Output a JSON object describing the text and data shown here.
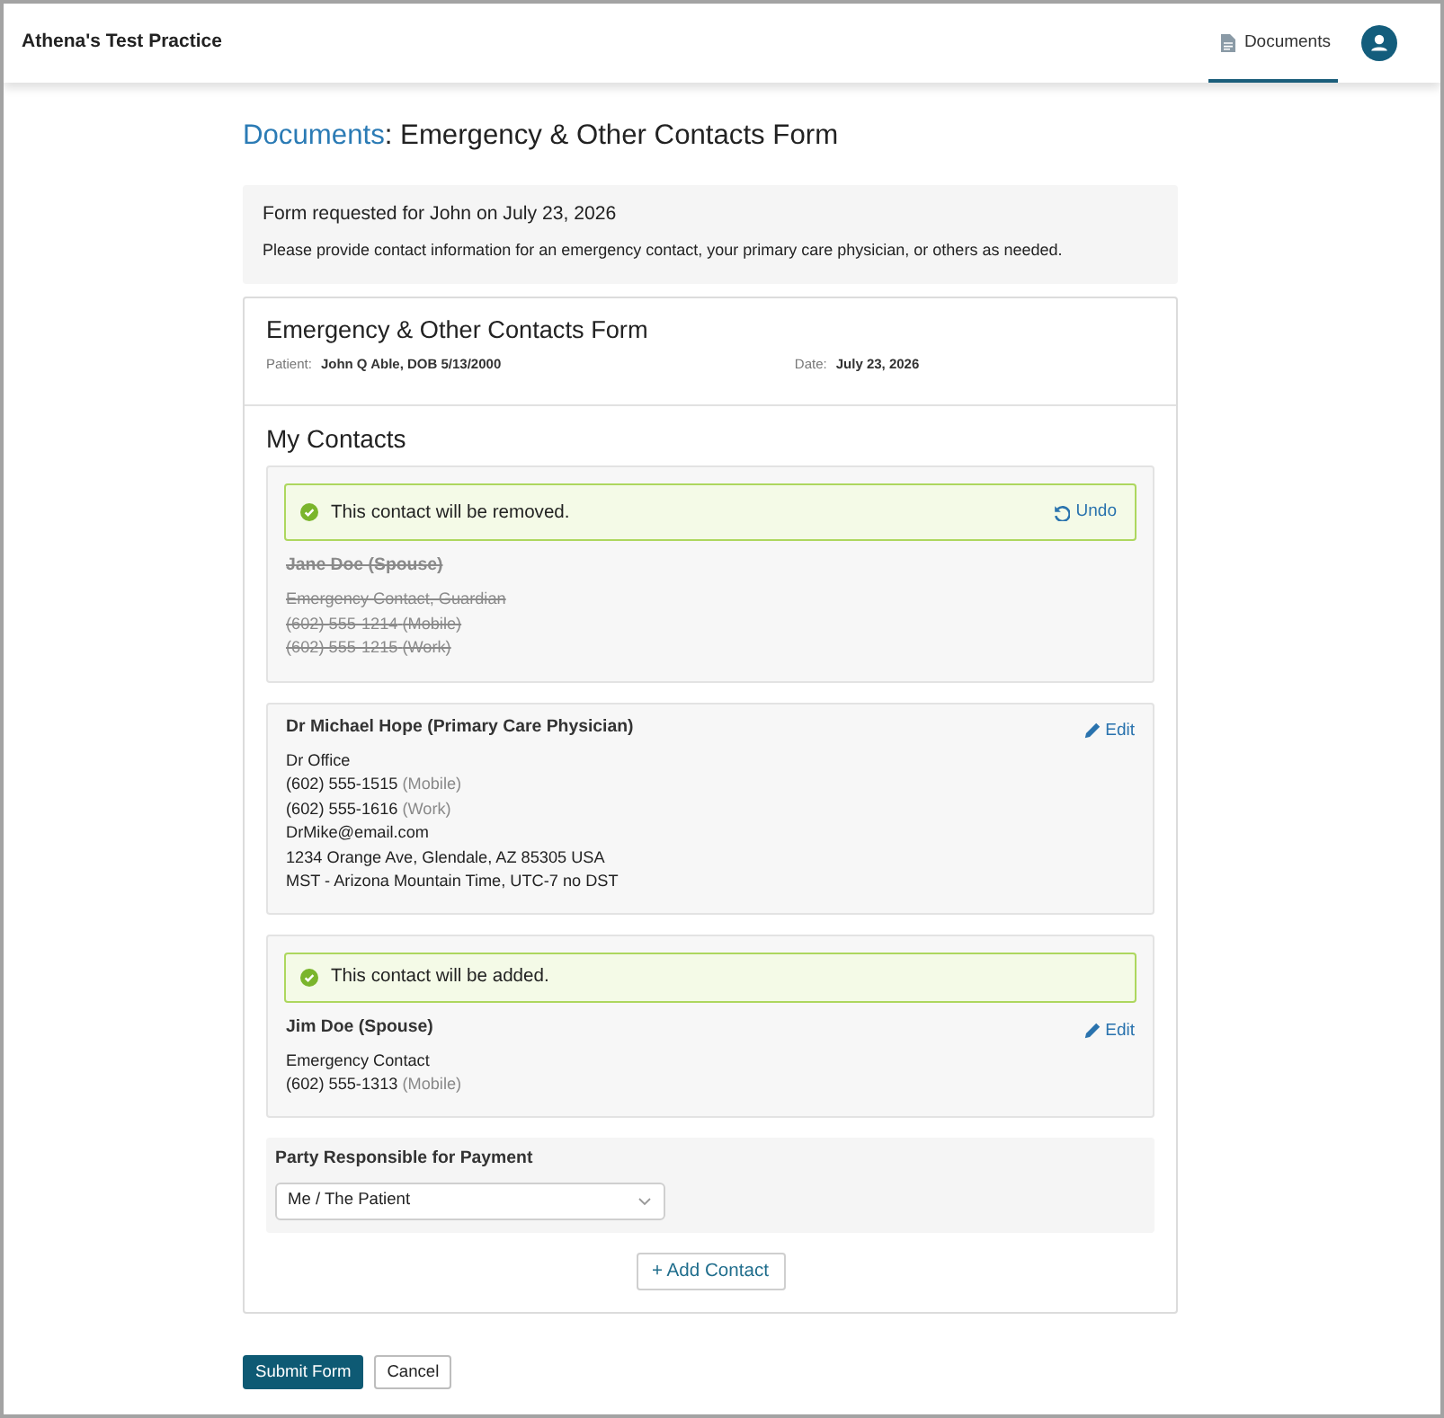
{
  "app": {
    "brand": "Athena's Test Practice",
    "tabs": [
      {
        "label": "Documents",
        "selected": true
      }
    ]
  },
  "heading": {
    "link": "Documents",
    "title": ": Emergency & Other Contacts Form"
  },
  "request": {
    "title": "Form requested for John on July 23, 2026",
    "text": "Please provide contact information for an emergency contact, your primary care physician, or others as needed."
  },
  "form": {
    "title": "Emergency & Other Contacts Form",
    "meta": [
      {
        "label": "Patient:",
        "value": "John Q Able, DOB 5/13/2000"
      },
      {
        "label": "Date:",
        "value": "July 23, 2026"
      }
    ],
    "section_title": "My Contacts",
    "contacts": [
      {
        "removed": true,
        "notice": {
          "text": "This contact will be removed.",
          "action": {
            "kind": "undo",
            "label": "Undo"
          }
        },
        "name": "Jane Doe (Spouse)",
        "details": [
          {
            "text": "Emergency Contact, Guardian"
          },
          {
            "text": "(602) 555-1214",
            "note": "(Mobile)"
          },
          {
            "text": "(602) 555-1215",
            "note": "(Work)"
          }
        ]
      },
      {
        "removed": false,
        "action": {
          "kind": "edit",
          "label": "Edit"
        },
        "name": "Dr Michael Hope (Primary Care Physician)",
        "details": [
          {
            "text": "Dr Office"
          },
          {
            "text": "(602) 555-1515",
            "note": "(Mobile)"
          },
          {
            "text": "(602) 555-1616",
            "note": "(Work)"
          },
          {
            "text": "DrMike@email.com"
          },
          {
            "text": "1234 Orange Ave, Glendale, AZ 85305 USA"
          },
          {
            "text": "MST - Arizona Mountain Time, UTC-7 no DST"
          }
        ]
      },
      {
        "removed": false,
        "notice": {
          "text": "This contact will be added."
        },
        "action": {
          "kind": "edit",
          "label": "Edit"
        },
        "name": "Jim Doe (Spouse)",
        "details": [
          {
            "text": "Emergency Contact"
          },
          {
            "text": "(602) 555-1313",
            "note": "(Mobile)"
          }
        ]
      }
    ],
    "payment": {
      "label": "Party Responsible for Payment",
      "value": "Me / The Patient"
    },
    "add_button": "+ Add Contact"
  },
  "actions": [
    {
      "label": "Submit Form",
      "kind": "primary"
    },
    {
      "label": "Cancel",
      "kind": "secondary"
    }
  ]
}
